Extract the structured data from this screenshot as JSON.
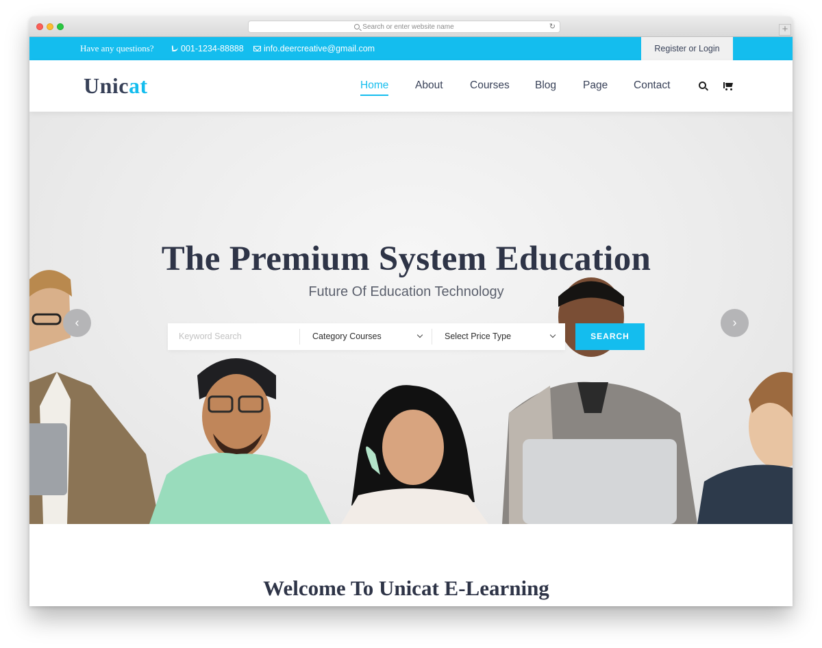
{
  "browser": {
    "url_placeholder": "Search or enter website name",
    "reload_glyph": "↻",
    "newtab_glyph": "+"
  },
  "topbar": {
    "question": "Have any questions?",
    "phone": "001-1234-88888",
    "email": "info.deercreative@gmail.com",
    "register": "Register or Login",
    "bg_color": "#14bdee"
  },
  "header": {
    "logo_part1": "Unic",
    "logo_part2": "at",
    "nav": [
      {
        "label": "Home",
        "active": true
      },
      {
        "label": "About"
      },
      {
        "label": "Courses"
      },
      {
        "label": "Blog"
      },
      {
        "label": "Page"
      },
      {
        "label": "Contact"
      }
    ],
    "icons": [
      "search-icon",
      "cart-icon"
    ]
  },
  "hero": {
    "title": "The Premium System Education",
    "subtitle": "Future Of Education Technology",
    "search": {
      "keyword_placeholder": "Keyword Search",
      "category": "Category Courses",
      "price": "Select Price Type",
      "button": "SEARCH"
    },
    "prev_glyph": "‹",
    "next_glyph": "›"
  },
  "welcome": {
    "title": "Welcome To Unicat E-Learning"
  },
  "colors": {
    "accent": "#14bdee",
    "heading": "#384158"
  }
}
